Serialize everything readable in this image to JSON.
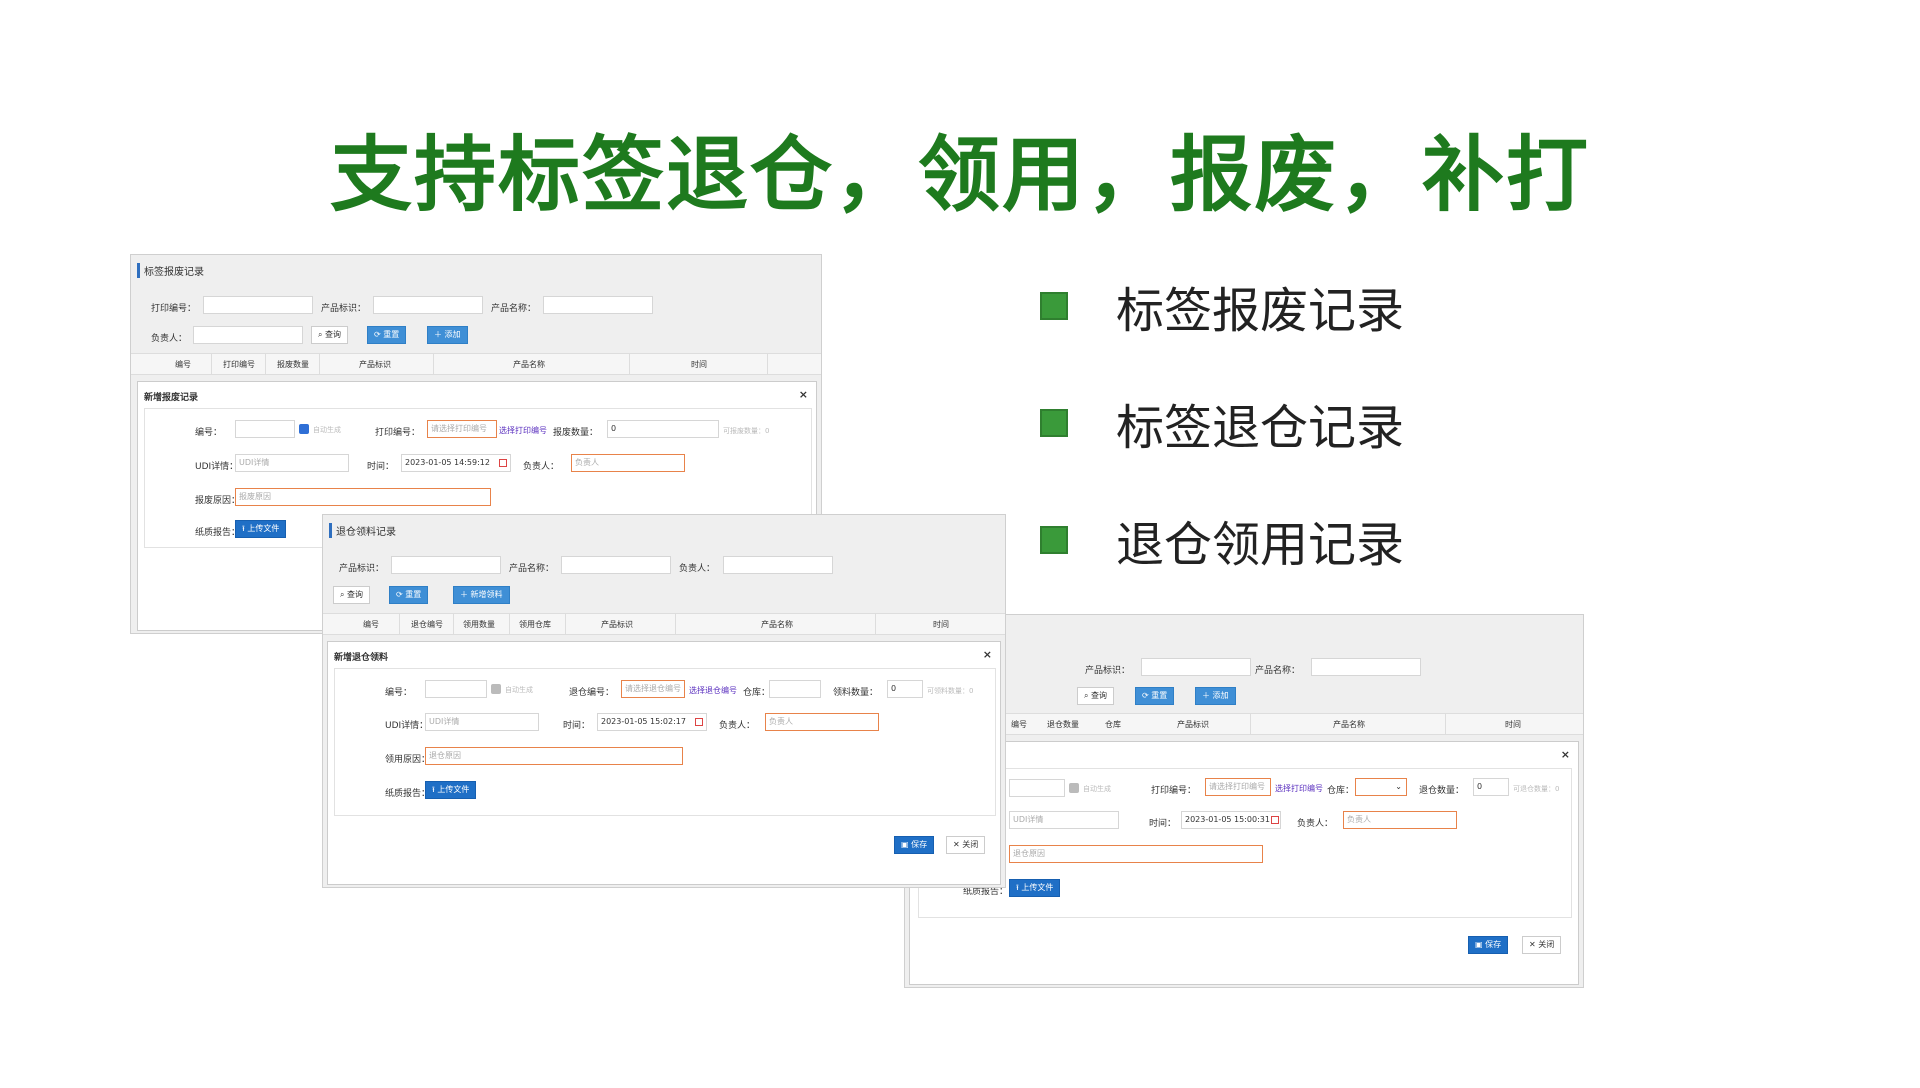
{
  "title": "支持标签退仓，领用，报废，补打",
  "bullets": [
    "标签报废记录",
    "标签退仓记录",
    "退仓领用记录"
  ],
  "colors": {
    "title": "#1e7a1e",
    "bullet": "#3a9a3a",
    "primary_btn": "#3f8fd6",
    "error_border": "#e8834a"
  },
  "panel1": {
    "header": "标签报废记录",
    "search": {
      "print_no": "打印编号：",
      "product_id": "产品标识：",
      "product_name": "产品名称：",
      "owner": "负责人："
    },
    "buttons": {
      "query": "查询",
      "reset": "重置",
      "add": "添加"
    },
    "columns": [
      "编号",
      "打印编号",
      "报废数量",
      "产品标识",
      "产品名称",
      "时间"
    ],
    "modal": {
      "title": "新增报废记录",
      "no_label": "编号：",
      "auto": "自动生成",
      "print_label": "打印编号：",
      "print_ph": "请选择打印编号",
      "print_link": "选择打印编号",
      "qty_label": "报废数量：",
      "qty_value": "0",
      "qty_hint": "可报废数量：0",
      "udi_label": "UDI详情：",
      "udi_ph": "UDI详情",
      "time_label": "时间：",
      "time_value": "2023-01-05 14:59:12",
      "owner_label": "负责人：",
      "owner_ph": "负责人",
      "reason_label": "报废原因：",
      "reason_ph": "报废原因",
      "report_label": "纸质报告：",
      "upload": "上传文件"
    }
  },
  "panel2": {
    "header": "退仓领料记录",
    "search": {
      "product_id": "产品标识：",
      "product_name": "产品名称：",
      "owner": "负责人："
    },
    "buttons": {
      "query": "查询",
      "reset": "重置",
      "add": "新增领料"
    },
    "columns": [
      "编号",
      "退仓编号",
      "领用数量",
      "领用仓库",
      "产品标识",
      "产品名称",
      "时间"
    ],
    "modal": {
      "title": "新增退仓领料",
      "no_label": "编号：",
      "auto": "自动生成",
      "return_label": "退仓编号：",
      "return_ph": "请选择退仓编号",
      "return_link": "选择退仓编号",
      "wh_label": "仓库：",
      "qty_label": "领料数量：",
      "qty_value": "0",
      "qty_hint": "可领料数量：0",
      "udi_label": "UDI详情：",
      "udi_ph": "UDI详情",
      "time_label": "时间：",
      "time_value": "2023-01-05 15:02:17",
      "owner_label": "负责人：",
      "owner_ph": "负责人",
      "reason_label": "领用原因：",
      "reason_ph": "退仓原因",
      "report_label": "纸质报告：",
      "upload": "上传文件",
      "save": "保存",
      "close": "关闭"
    }
  },
  "panel3": {
    "search": {
      "product_id": "产品标识：",
      "product_name": "产品名称："
    },
    "buttons": {
      "query": "查询",
      "reset": "重置",
      "add": "添加"
    },
    "columns": [
      "编号",
      "退仓数量",
      "仓库",
      "产品标识",
      "产品名称",
      "时间"
    ],
    "modal": {
      "auto": "自动生成",
      "print_label": "打印编号：",
      "print_ph": "请选择打印编号",
      "print_link": "选择打印编号",
      "wh_label": "仓库：",
      "qty_label": "退仓数量：",
      "qty_value": "0",
      "qty_hint": "可退仓数量：0",
      "udi_ph": "UDI详情",
      "time_label": "时间：",
      "time_value": "2023-01-05 15:00:31",
      "owner_label": "负责人：",
      "owner_ph": "负责人",
      "reason_ph": "退仓原因",
      "report_label": "纸质报告：",
      "upload": "上传文件",
      "save": "保存",
      "close": "关闭"
    }
  }
}
